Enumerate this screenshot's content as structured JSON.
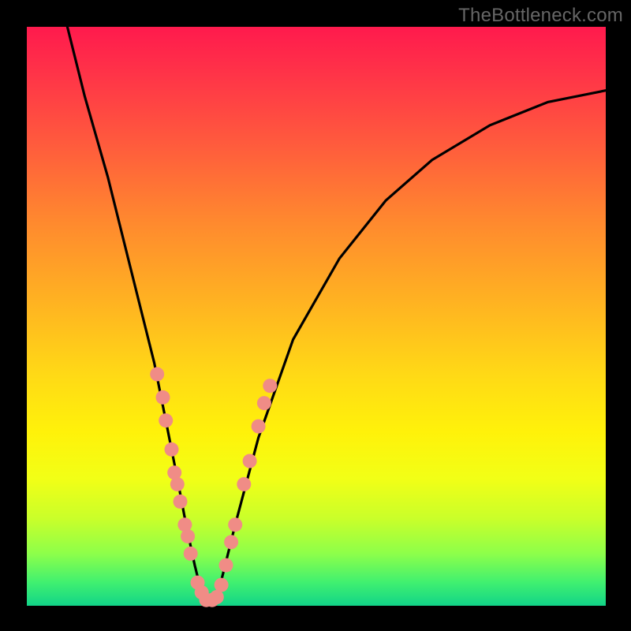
{
  "watermark": "TheBottleneck.com",
  "chart_data": {
    "type": "line",
    "title": "",
    "xlabel": "",
    "ylabel": "",
    "xlim": [
      0,
      100
    ],
    "ylim": [
      0,
      100
    ],
    "curve": {
      "name": "bottleneck-curve",
      "x": [
        7,
        10,
        14,
        18,
        22,
        24,
        26,
        27.5,
        29,
        30,
        31,
        32,
        33,
        34,
        36,
        40,
        46,
        54,
        62,
        70,
        80,
        90,
        100
      ],
      "y": [
        100,
        88,
        74,
        58,
        42,
        32,
        22,
        14,
        7,
        3,
        0.5,
        0.5,
        2,
        6,
        14,
        29,
        46,
        60,
        70,
        77,
        83,
        87,
        89
      ]
    },
    "markers": {
      "name": "sample-points",
      "color": "#f08c86",
      "radius": 9,
      "points": [
        {
          "x": 22.5,
          "y": 40
        },
        {
          "x": 23.5,
          "y": 36
        },
        {
          "x": 24.0,
          "y": 32
        },
        {
          "x": 25.0,
          "y": 27
        },
        {
          "x": 25.5,
          "y": 23
        },
        {
          "x": 26.0,
          "y": 21
        },
        {
          "x": 26.5,
          "y": 18
        },
        {
          "x": 27.3,
          "y": 14
        },
        {
          "x": 27.8,
          "y": 12
        },
        {
          "x": 28.3,
          "y": 9
        },
        {
          "x": 29.5,
          "y": 4
        },
        {
          "x": 30.2,
          "y": 2.3
        },
        {
          "x": 31.0,
          "y": 1.0
        },
        {
          "x": 32.0,
          "y": 1.0
        },
        {
          "x": 32.8,
          "y": 1.5
        },
        {
          "x": 33.6,
          "y": 3.6
        },
        {
          "x": 34.4,
          "y": 7
        },
        {
          "x": 35.3,
          "y": 11
        },
        {
          "x": 36.0,
          "y": 14
        },
        {
          "x": 37.5,
          "y": 21
        },
        {
          "x": 38.5,
          "y": 25
        },
        {
          "x": 40.0,
          "y": 31
        },
        {
          "x": 41.0,
          "y": 35
        },
        {
          "x": 42.0,
          "y": 38
        }
      ]
    }
  }
}
